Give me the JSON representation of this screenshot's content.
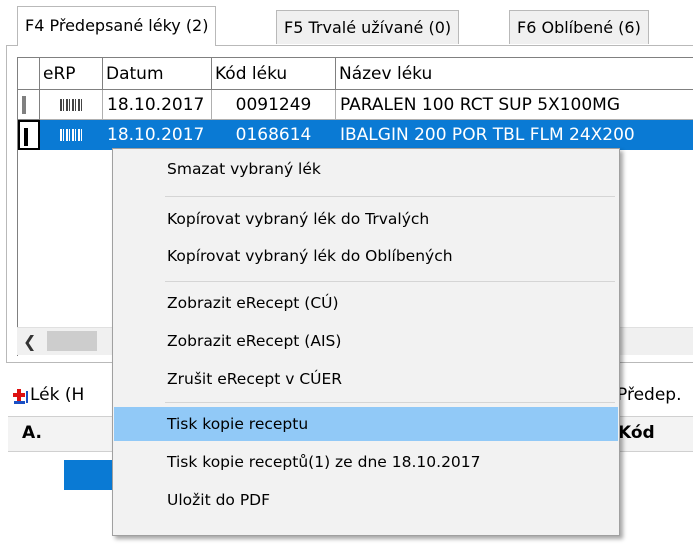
{
  "tabs": [
    {
      "label": "F4 Předepsané léky (2)",
      "active": true
    },
    {
      "label": "F5 Trvalé užívané (0)",
      "active": false
    },
    {
      "label": "F6 Oblíbené (6)",
      "active": false
    }
  ],
  "grid": {
    "columns": [
      "eRP",
      "Datum",
      "Kód léku",
      "Název léku"
    ],
    "rows": [
      {
        "date": "18.10.2017",
        "code": "0091249",
        "name": "PARALEN 100 RCT SUP 5X100MG",
        "selected": false
      },
      {
        "date": "18.10.2017",
        "code": "0168614",
        "name": "IBALGIN 200 POR TBL FLM 24X200",
        "selected": true
      }
    ]
  },
  "context_menu": {
    "items": [
      {
        "label": "Smazat vybraný lék",
        "hover": false
      },
      {
        "label": "Kopírovat vybraný lék do Trvalých",
        "hover": false
      },
      {
        "label": "Kopírovat vybraný lék do Oblíbených",
        "hover": false
      },
      {
        "label": "Zobrazit eRecept (CÚ)",
        "hover": false
      },
      {
        "label": "Zobrazit eRecept (AIS)",
        "hover": false
      },
      {
        "label": "Zrušit eRecept v CÚER",
        "hover": false
      },
      {
        "label": "Tisk kopie receptu",
        "hover": true
      },
      {
        "label": "Tisk kopie receptů(1) ze dne 18.10.2017",
        "hover": false
      },
      {
        "label": "Uložit do PDF",
        "hover": false
      }
    ]
  },
  "lower": {
    "lek_label": "Lék (H",
    "predep_label": "Předep.",
    "col_a": "A.",
    "col_kod": "Kód"
  },
  "colors": {
    "selection": "#0a7ad4",
    "menu_hover": "#91c9f7",
    "menu_bg": "#f2f2f2"
  }
}
